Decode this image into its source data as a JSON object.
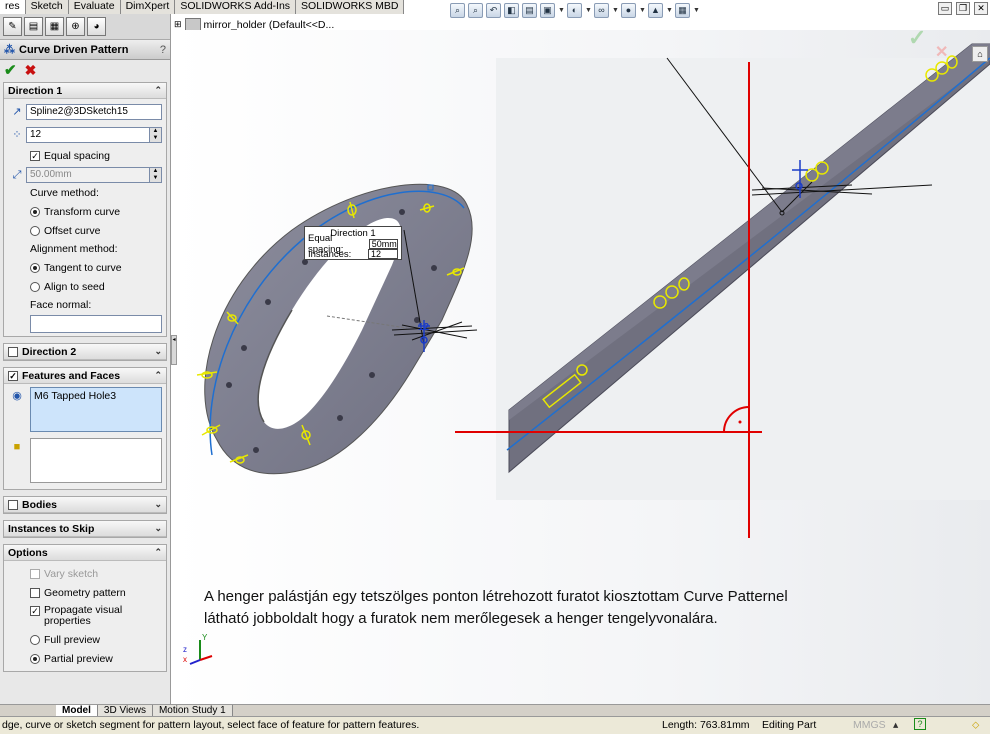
{
  "tabs": [
    {
      "label": "res",
      "active": true
    },
    {
      "label": "Sketch"
    },
    {
      "label": "Evaluate"
    },
    {
      "label": "DimXpert"
    },
    {
      "label": "SOLIDWORKS Add-Ins"
    },
    {
      "label": "SOLIDWORKS MBD"
    }
  ],
  "view_toolbar_icons": [
    "zoom-to-fit-icon",
    "zoom-area-icon",
    "previous-view-icon",
    "section-view-icon",
    "dynamic-annotation-icon",
    "view-orientation-icon",
    "display-style-icon",
    "hide-show-icon",
    "edit-appearance-icon",
    "apply-scene-icon",
    "view-settings-icon"
  ],
  "tree": {
    "label": "mirror_holder  (Default<<D..."
  },
  "pm": {
    "title": "Curve Driven Pattern",
    "help": "?",
    "direction1": {
      "header": "Direction 1",
      "curve_value": "Spline2@3DSketch15",
      "instances_value": "12",
      "equal_spacing_label": "Equal spacing",
      "spacing_value": "50.00mm",
      "curve_method_label": "Curve method:",
      "transform_curve_label": "Transform curve",
      "offset_curve_label": "Offset curve",
      "alignment_method_label": "Alignment method:",
      "tangent_to_curve_label": "Tangent to curve",
      "align_to_seed_label": "Align to seed",
      "face_normal_label": "Face normal:"
    },
    "direction2": {
      "header": "Direction 2"
    },
    "features": {
      "header": "Features and Faces",
      "item": "M6 Tapped Hole3"
    },
    "bodies": {
      "header": "Bodies"
    },
    "skip": {
      "header": "Instances to Skip"
    },
    "options": {
      "header": "Options",
      "vary_sketch": "Vary sketch",
      "geometry_pattern": "Geometry pattern",
      "propagate": "Propagate visual properties",
      "full_preview": "Full preview",
      "partial_preview": "Partial preview"
    }
  },
  "callout": {
    "title": "Direction 1",
    "spacing_label": "Equal spacing:",
    "spacing_value": "50mm",
    "instances_label": "Instances:",
    "instances_value": "12"
  },
  "caption": {
    "line1": "A henger  palástján egy tetszölges ponton létrehozott furatot kiosztottam Curve Patternel",
    "line2": "látható jobboldalt hogy a furatok nem merőlegesek a henger tengelyvonalára."
  },
  "triad": {
    "z": "z",
    "x": "x",
    "y": "Y"
  },
  "bottom_tabs": [
    {
      "label": "Model",
      "active": true
    },
    {
      "label": "3D Views"
    },
    {
      "label": "Motion Study 1"
    }
  ],
  "status": {
    "message": "dge, curve or sketch segment for pattern layout, select face of feature for pattern features.",
    "length": "Length: 763.81mm",
    "mode": "Editing Part",
    "units": "MMGS"
  },
  "colors": {
    "accent": "#1f6fd0",
    "sketch_red": "#e00000",
    "hole_yellow": "#e8e800",
    "part_gray": "#7e7f90"
  }
}
